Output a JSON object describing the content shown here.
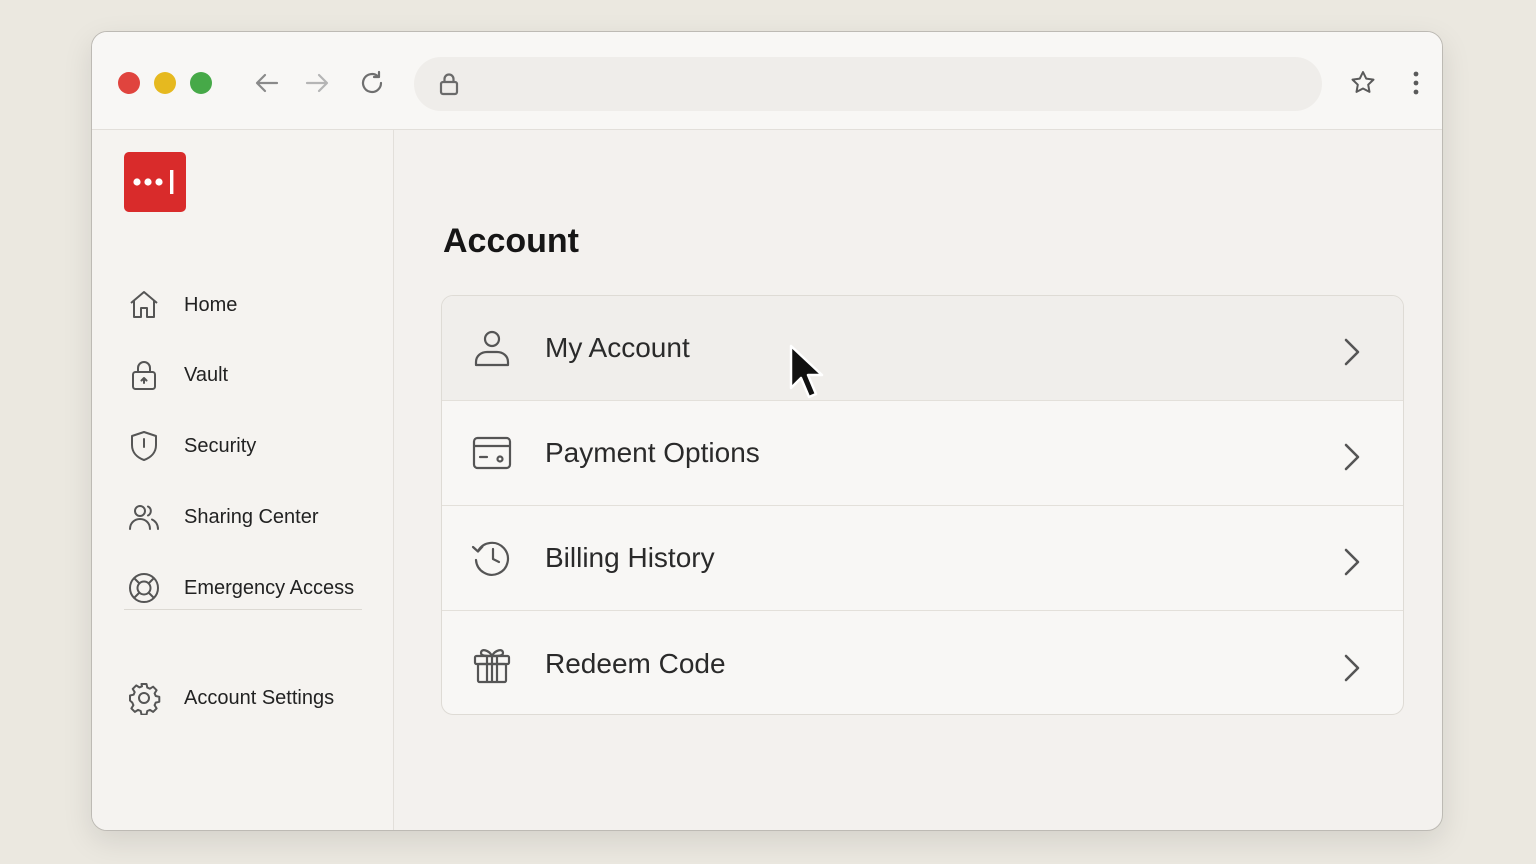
{
  "browser": {
    "url": ""
  },
  "sidebar": {
    "items": [
      {
        "label": "Home",
        "icon": "home-icon"
      },
      {
        "label": "Vault",
        "icon": "lock-icon"
      },
      {
        "label": "Security",
        "icon": "shield-icon"
      },
      {
        "label": "Sharing Center",
        "icon": "users-icon"
      },
      {
        "label": "Emergency Access",
        "icon": "lifebuoy-icon"
      }
    ],
    "footer_items": [
      {
        "label": "Account Settings",
        "icon": "gear-icon"
      }
    ]
  },
  "main": {
    "title": "Account",
    "rows": [
      {
        "label": "My Account",
        "icon": "user-icon"
      },
      {
        "label": "Payment Options",
        "icon": "credit-card-icon"
      },
      {
        "label": "Billing History",
        "icon": "history-icon"
      },
      {
        "label": "Redeem Code",
        "icon": "gift-icon"
      }
    ]
  },
  "colors": {
    "brand": "#d92b2b",
    "background": "#ebe8e0"
  }
}
